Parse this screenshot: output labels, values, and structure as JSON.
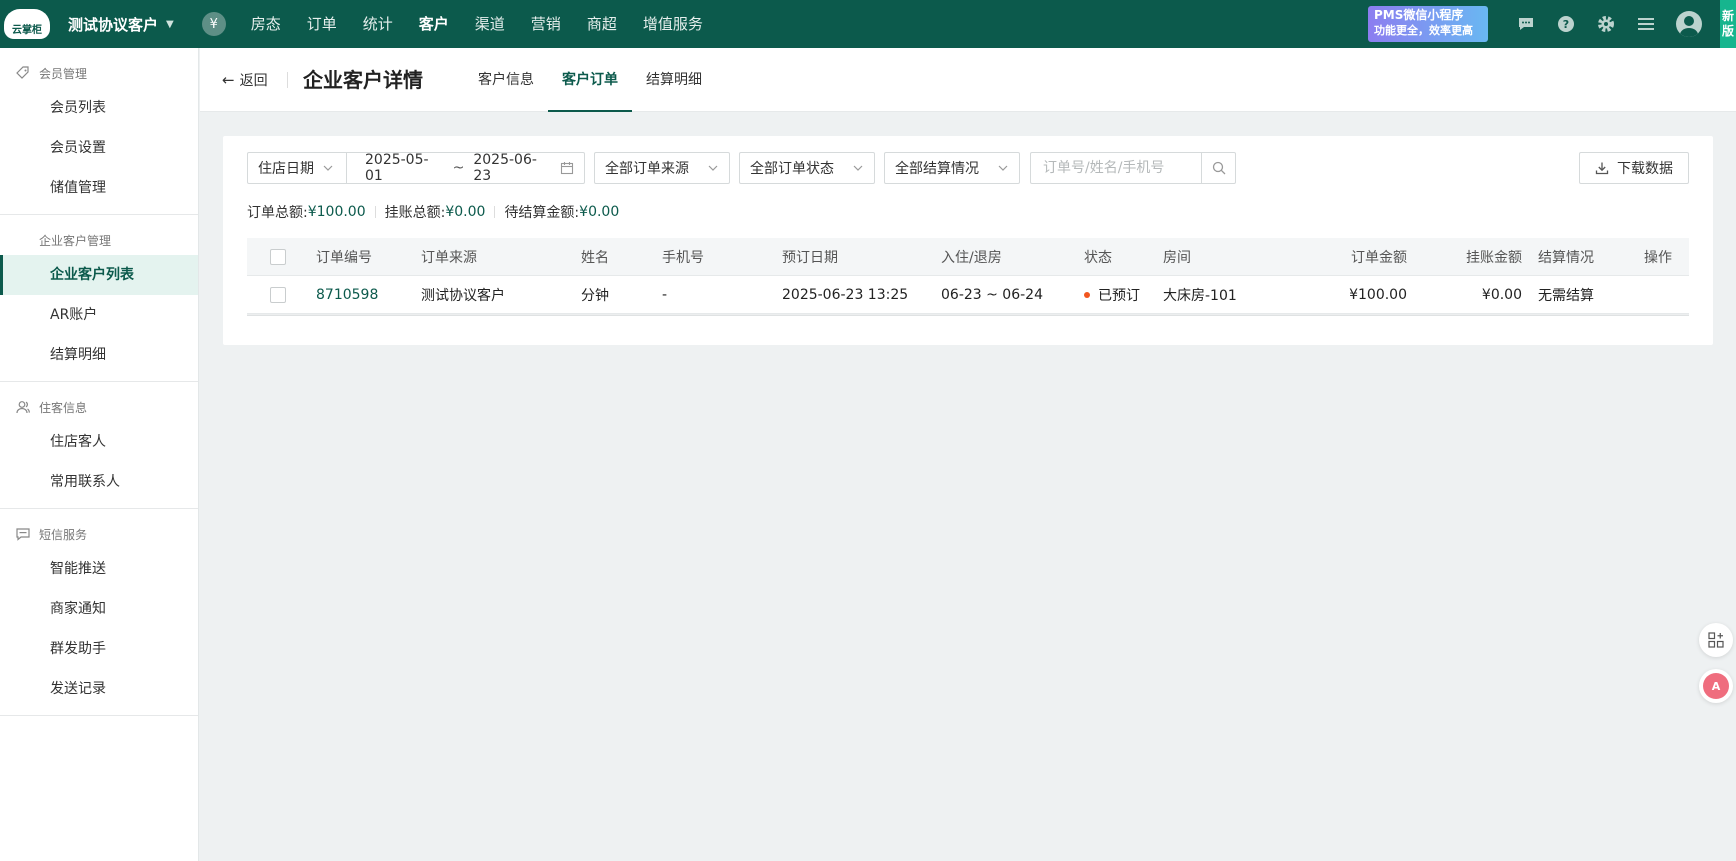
{
  "topbar": {
    "logo_text": "云掌柜",
    "hotel_name": "测试协议客户",
    "yen_symbol": "¥",
    "nav": [
      "房态",
      "订单",
      "统计",
      "客户",
      "渠道",
      "营销",
      "商超",
      "增值服务"
    ],
    "nav_active": "客户",
    "promo_line1": "PMS微信小程序",
    "promo_line2": "功能更全，效率更高",
    "new_version": [
      "新",
      "版"
    ]
  },
  "sidebar": {
    "groups": [
      {
        "title": "会员管理",
        "icon": "tag-icon",
        "items": [
          "会员列表",
          "会员设置",
          "储值管理"
        ]
      },
      {
        "title": "企业客户管理",
        "icon": "",
        "items": [
          "企业客户列表",
          "AR账户",
          "结算明细"
        ]
      },
      {
        "title": "住客信息",
        "icon": "people-icon",
        "items": [
          "住店客人",
          "常用联系人"
        ]
      },
      {
        "title": "短信服务",
        "icon": "message-icon",
        "items": [
          "智能推送",
          "商家通知",
          "群发助手",
          "发送记录"
        ]
      }
    ],
    "active_item": "企业客户列表"
  },
  "page": {
    "back_label": "返回",
    "title": "企业客户详情",
    "tabs": [
      "客户信息",
      "客户订单",
      "结算明细"
    ],
    "active_tab": "客户订单"
  },
  "filters": {
    "date_type": "住店日期",
    "date_start": "2025-05-01",
    "date_sep": "~",
    "date_end": "2025-06-23",
    "source": "全部订单来源",
    "status": "全部订单状态",
    "settlement": "全部结算情况",
    "search_placeholder": "订单号/姓名/手机号",
    "download_label": "下载数据"
  },
  "summary": {
    "total_label": "订单总额:",
    "total_value": "¥100.00",
    "account_label": "挂账总额:",
    "account_value": "¥0.00",
    "pending_label": "待结算金额:",
    "pending_value": "¥0.00"
  },
  "table": {
    "headers": [
      "订单编号",
      "订单来源",
      "姓名",
      "手机号",
      "预订日期",
      "入住/退房",
      "状态",
      "房间",
      "订单金额",
      "挂账金额",
      "结算情况",
      "操作"
    ],
    "rows": [
      {
        "order_no": "8710598",
        "source": "测试协议客户",
        "name": "分钟",
        "phone": "-",
        "booked_at": "2025-06-23 13:25",
        "stay": "06-23 ~ 06-24",
        "status": "已预订",
        "room": "大床房-101",
        "amount": "¥100.00",
        "on_account": "¥0.00",
        "settlement": "无需结算"
      }
    ]
  },
  "floating": {
    "apps_icon": "apps-icon",
    "translate_icon": "translate-icon"
  },
  "colors": {
    "brand": "#0c5a4c",
    "status_dot": "#f2561f",
    "new_badge": "#16b58e"
  }
}
